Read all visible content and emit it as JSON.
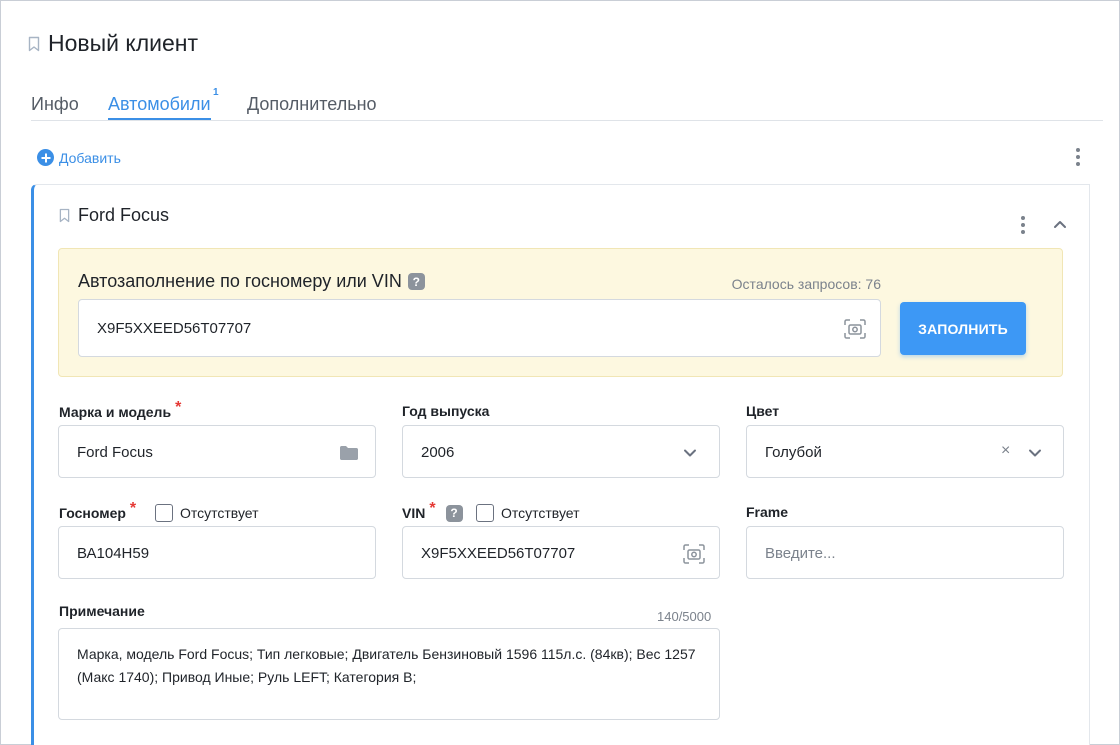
{
  "page": {
    "title": "Новый клиент"
  },
  "tabs": [
    {
      "label": "Инфо",
      "badge": ""
    },
    {
      "label": "Автомобили",
      "badge": "1"
    },
    {
      "label": "Дополнительно",
      "badge": ""
    }
  ],
  "toolbar": {
    "add_label": "Добавить"
  },
  "vehicle": {
    "title": "Ford Focus",
    "autofill": {
      "heading": "Автозаполнение по госномеру или VIN",
      "remaining": "Осталось запросов: 76",
      "value": "X9F5XXEED56T07707",
      "button": "ЗАПОЛНИТЬ"
    },
    "fields": {
      "make_model": {
        "label": "Марка и модель",
        "value": "Ford Focus"
      },
      "year": {
        "label": "Год выпуска",
        "value": "2006"
      },
      "color": {
        "label": "Цвет",
        "value": "Голубой"
      },
      "plate": {
        "label": "Госномер",
        "value": "ВА104Н59",
        "missing_label": "Отсутствует"
      },
      "vin": {
        "label": "VIN",
        "value": "X9F5XXEED56T07707",
        "missing_label": "Отсутствует"
      },
      "frame": {
        "label": "Frame",
        "placeholder": "Введите..."
      },
      "note": {
        "label": "Примечание",
        "counter": "140/5000",
        "value": "Марка, модель Ford Focus; Тип легковые; Двигатель Бензиновый 1596 115л.с. (84кв); Вес 1257 (Макс 1740); Привод Иные; Руль LEFT; Категория B;"
      }
    }
  },
  "colors": {
    "accent": "#3b8fe6",
    "button": "#3d98f5",
    "autofill_bg": "#fdf8e0",
    "required": "#e53935"
  }
}
